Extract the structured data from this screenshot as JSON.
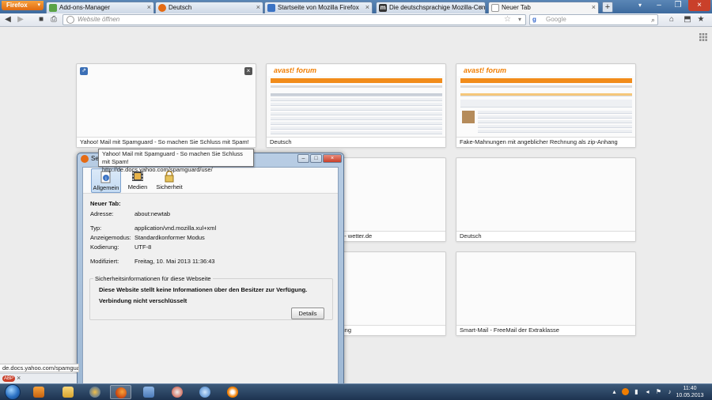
{
  "app": {
    "menu_button": "Firefox"
  },
  "tabs": [
    {
      "title": "Add-ons-Manager",
      "icon": "puzzle-icon"
    },
    {
      "title": "Deutsch",
      "icon": "firefox-icon"
    },
    {
      "title": "Startseite von Mozilla Firefox",
      "icon": "firefox-icon"
    },
    {
      "title": "Die deutschsprachige Mozilla-Comm...",
      "icon": "mozilla-m-icon"
    },
    {
      "title": "Neuer Tab",
      "icon": "blank-page-icon"
    }
  ],
  "nav": {
    "url_placeholder": "Website öffnen",
    "search_placeholder": "Google",
    "search_engine": "g"
  },
  "tiles": [
    {
      "label": "Yahoo! Mail mit Spamguard - So machen Sie Schluss mit Spam!"
    },
    {
      "label": "Deutsch"
    },
    {
      "label": "Fake-Mahnungen mit angeblicher Rechnung als zip-Anhang"
    },
    {
      "label": "etterbericht für Deutschland - wetter.de"
    },
    {
      "label": "Deutsch"
    },
    {
      "label": "alle Codes und ihre Bedeutung"
    },
    {
      "label": "Smart-Mail - FreeMail der Extraklasse"
    }
  ],
  "forum_logo": "avast! forum",
  "tooltip": {
    "line1": "Yahoo! Mail mit Spamguard - So machen Sie Schluss mit Spam!",
    "line2": "http://de.docs.yahoo.com/spamguard/use/"
  },
  "page_info": {
    "window_title_partial": "Seit",
    "tabs": [
      {
        "label": "Allgemein",
        "icon": "info-page-icon"
      },
      {
        "label": "Medien",
        "icon": "media-film-icon"
      },
      {
        "label": "Sicherheit",
        "icon": "lock-icon"
      }
    ],
    "heading": "Neuer Tab:",
    "address_key": "Adresse:",
    "address_val": "about:newtab",
    "type_key": "Typ:",
    "type_val": "application/vnd.mozilla.xul+xml",
    "mode_key": "Anzeigemodus:",
    "mode_val": "Standardkonformer Modus",
    "enc_key": "Kodierung:",
    "enc_val": "UTF-8",
    "mod_key": "Modifiziert:",
    "mod_val": "Freitag, 10. Mai 2013 11:36:43",
    "sec_title": "Sicherheitsinformationen für diese Webseite",
    "sec_msg1": "Diese Website stellt keine Informationen über den Besitzer zur Verfügung.",
    "sec_msg2": "Verbindung nicht verschlüsselt",
    "details_button": "Details"
  },
  "status": {
    "url": "de.docs.yahoo.com/spamguard"
  },
  "taskbar": {
    "items": [
      "media-player-icon",
      "explorer-folder-icon",
      "thunderbird-icon",
      "firefox-icon",
      "xp-mode-icon",
      "paint-icon",
      "ccleaner-icon",
      "avast-icon"
    ],
    "time": "11:40",
    "date": "10.05.2013"
  },
  "colors": {
    "accent": "#f28c1a",
    "tab_strip": "#3d6a9e",
    "taskbar": "#1d3350"
  }
}
